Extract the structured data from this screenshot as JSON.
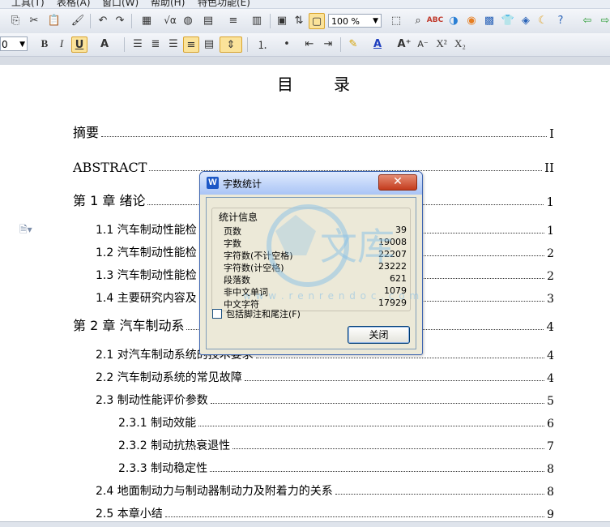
{
  "menubar": {
    "items": [
      "工具(T)",
      "表格(A)",
      "窗口(W)",
      "帮助(H)",
      "特色功能(E)"
    ]
  },
  "toolbar": {
    "zoom_value": "100 %",
    "font_size_value": "0",
    "bold_label": "B",
    "italic_label": "I",
    "underline_label": "U"
  },
  "document": {
    "toc_heading_chars": [
      "目",
      "录"
    ],
    "toc": [
      {
        "level": 1,
        "label": "摘要",
        "page": "I"
      },
      {
        "level": 1,
        "label": "ABSTRACT",
        "page": "II"
      },
      {
        "level": 1,
        "label": "第 1 章  绪论",
        "page": "1"
      },
      {
        "level": 2,
        "label": "1.1  汽车制动性能检",
        "page": "1"
      },
      {
        "level": 2,
        "label": "1.2  汽车制动性能检",
        "page": "2"
      },
      {
        "level": 2,
        "label": "1.3  汽车制动性能检",
        "page": "2"
      },
      {
        "level": 2,
        "label": "1.4  主要研究内容及",
        "page": "3"
      },
      {
        "level": 1,
        "label": "第 2 章  汽车制动系",
        "page": "4"
      },
      {
        "level": 2,
        "label": "2.1  对汽车制动系统的技术要求",
        "page": "4"
      },
      {
        "level": 2,
        "label": "2.2  汽车制动系统的常见故障",
        "page": "4"
      },
      {
        "level": 2,
        "label": "2.3  制动性能评价参数",
        "page": "5"
      },
      {
        "level": 3,
        "label": "2.3.1  制动效能",
        "page": "6"
      },
      {
        "level": 3,
        "label": "2.3.2  制动抗热衰退性",
        "page": "7"
      },
      {
        "level": 3,
        "label": "2.3.3  制动稳定性",
        "page": "8"
      },
      {
        "level": 2,
        "label": "2.4  地面制动力与制动器制动力及附着力的关系",
        "page": "8"
      },
      {
        "level": 2,
        "label": "2.5  本章小结",
        "page": "9"
      }
    ]
  },
  "dialog": {
    "title": "字数统计",
    "logo_letter": "W",
    "close_glyph": "✕",
    "group_label": "统计信息",
    "stats": [
      {
        "label": "页数",
        "value": "39"
      },
      {
        "label": "字数",
        "value": "19008"
      },
      {
        "label": "字符数(不计空格)",
        "value": "22207"
      },
      {
        "label": "字符数(计空格)",
        "value": "23222"
      },
      {
        "label": "段落数",
        "value": "621"
      },
      {
        "label": "非中文单词",
        "value": "1079"
      },
      {
        "label": "中文字符",
        "value": "17929"
      }
    ],
    "checkbox_label": "包括脚注和尾注(F)",
    "checkbox_checked": false,
    "close_button_label": "关闭"
  },
  "watermark": {
    "text": "文库",
    "url_text": "w w w . r e n r e n d o c . c o m"
  },
  "colors": {
    "dialog_border": "#3b63b0",
    "dialog_bg": "#ece9d8",
    "title_gradient_top": "#dfeafe",
    "title_gradient_bottom": "#a9c4f5",
    "close_red": "#c43b1d",
    "selected_button": "#fbe39a",
    "watermark": "#8fc3e6"
  }
}
